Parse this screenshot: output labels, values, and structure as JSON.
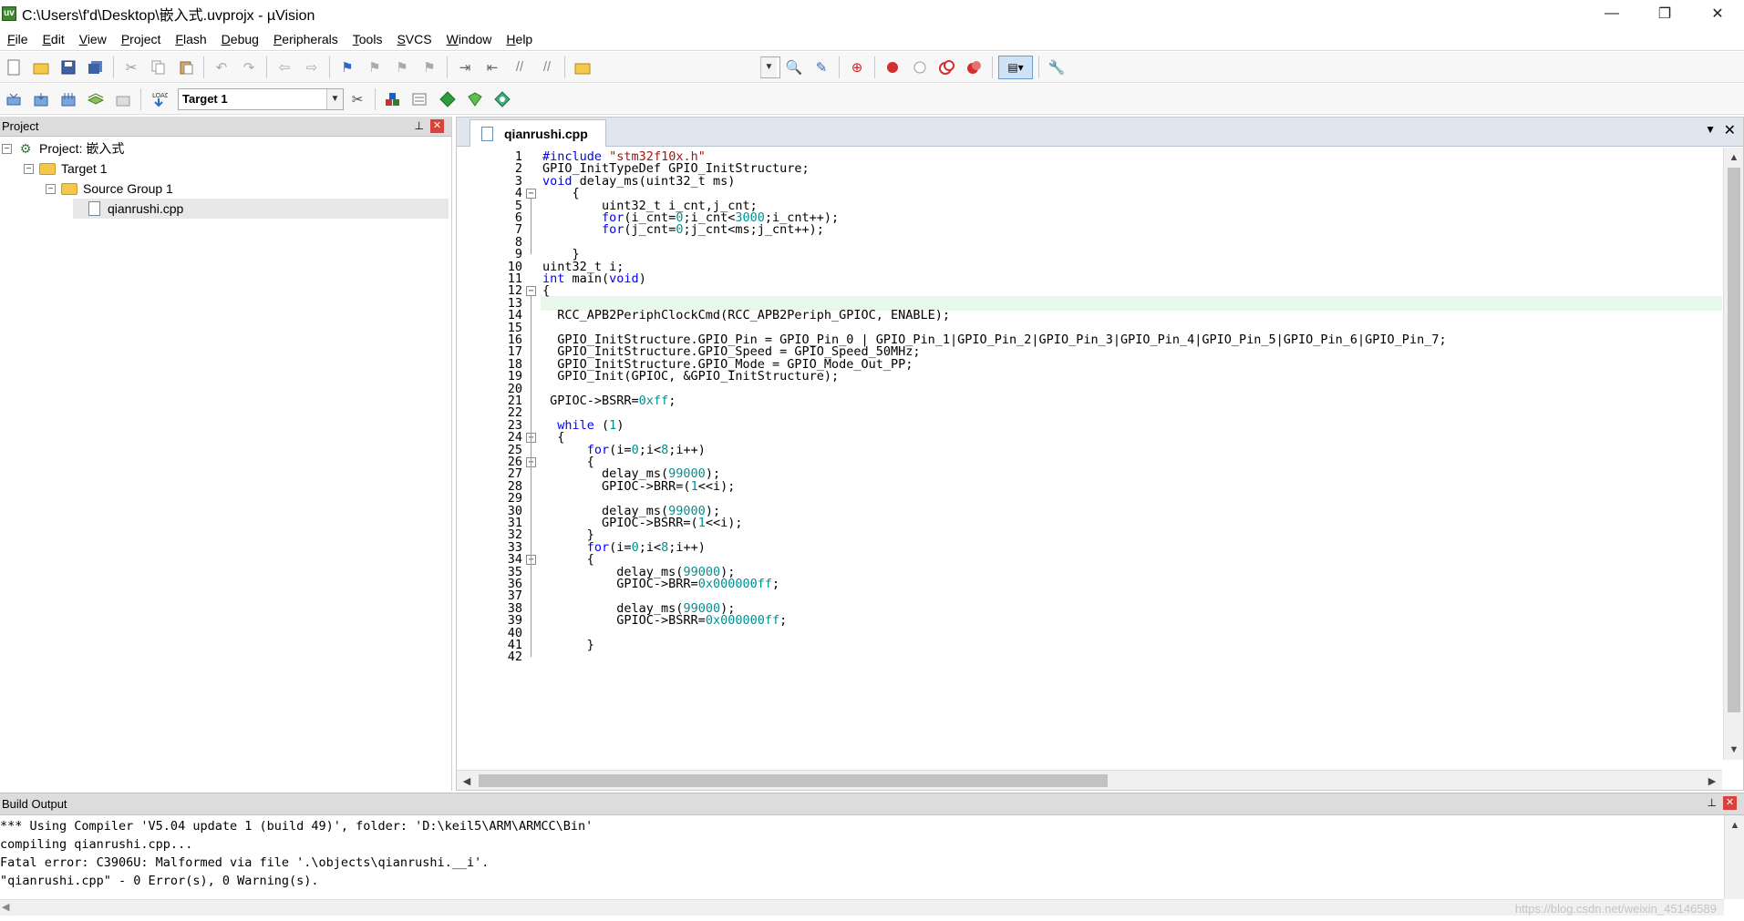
{
  "window": {
    "title": "C:\\Users\\f'd\\Desktop\\嵌入式.uvprojx - µVision",
    "app_icon": "uv",
    "minimize": "—",
    "restore": "❐",
    "close": "✕"
  },
  "menu": [
    "File",
    "Edit",
    "View",
    "Project",
    "Flash",
    "Debug",
    "Peripherals",
    "Tools",
    "SVCS",
    "Window",
    "Help"
  ],
  "toolbar2": {
    "target_value": "Target 1"
  },
  "project_panel": {
    "title": "Project",
    "pin": "⊥",
    "close": "✕",
    "tree": {
      "project": "Project: 嵌入式",
      "target": "Target 1",
      "group": "Source Group 1",
      "file": "qianrushi.cpp"
    }
  },
  "editor": {
    "tab_label": "qianrushi.cpp",
    "tab_menu": "▼",
    "tab_close": "✕",
    "lines": [
      {
        "n": "1",
        "text": "#include \"stm32f10x.h\""
      },
      {
        "n": "2",
        "text": "GPIO_InitTypeDef GPIO_InitStructure;"
      },
      {
        "n": "3",
        "text": "void delay_ms(uint32_t ms)"
      },
      {
        "n": "4",
        "text": "    {"
      },
      {
        "n": "5",
        "text": "        uint32_t i_cnt,j_cnt;"
      },
      {
        "n": "6",
        "text": "        for(i_cnt=0;i_cnt<3000;i_cnt++);"
      },
      {
        "n": "7",
        "text": "        for(j_cnt=0;j_cnt<ms;j_cnt++);"
      },
      {
        "n": "8",
        "text": ""
      },
      {
        "n": "9",
        "text": "    }"
      },
      {
        "n": "10",
        "text": "uint32_t i;"
      },
      {
        "n": "11",
        "text": "int main(void)"
      },
      {
        "n": "12",
        "text": "{"
      },
      {
        "n": "13",
        "text": ""
      },
      {
        "n": "14",
        "text": "  RCC_APB2PeriphClockCmd(RCC_APB2Periph_GPIOC, ENABLE);"
      },
      {
        "n": "15",
        "text": ""
      },
      {
        "n": "16",
        "text": "  GPIO_InitStructure.GPIO_Pin = GPIO_Pin_0 | GPIO_Pin_1|GPIO_Pin_2|GPIO_Pin_3|GPIO_Pin_4|GPIO_Pin_5|GPIO_Pin_6|GPIO_Pin_7;"
      },
      {
        "n": "17",
        "text": "  GPIO_InitStructure.GPIO_Speed = GPIO_Speed_50MHz;"
      },
      {
        "n": "18",
        "text": "  GPIO_InitStructure.GPIO_Mode = GPIO_Mode_Out_PP;"
      },
      {
        "n": "19",
        "text": "  GPIO_Init(GPIOC, &GPIO_InitStructure);"
      },
      {
        "n": "20",
        "text": ""
      },
      {
        "n": "21",
        "text": " GPIOC->BSRR=0xff;"
      },
      {
        "n": "22",
        "text": ""
      },
      {
        "n": "23",
        "text": "  while (1)"
      },
      {
        "n": "24",
        "text": "  {"
      },
      {
        "n": "25",
        "text": "      for(i=0;i<8;i++)"
      },
      {
        "n": "26",
        "text": "      {"
      },
      {
        "n": "27",
        "text": "        delay_ms(99000);"
      },
      {
        "n": "28",
        "text": "        GPIOC->BRR=(1<<i);"
      },
      {
        "n": "29",
        "text": ""
      },
      {
        "n": "30",
        "text": "        delay_ms(99000);"
      },
      {
        "n": "31",
        "text": "        GPIOC->BSRR=(1<<i);"
      },
      {
        "n": "32",
        "text": "      }"
      },
      {
        "n": "33",
        "text": "      for(i=0;i<8;i++)"
      },
      {
        "n": "34",
        "text": "      {"
      },
      {
        "n": "35",
        "text": "          delay_ms(99000);"
      },
      {
        "n": "36",
        "text": "          GPIOC->BRR=0x000000ff;"
      },
      {
        "n": "37",
        "text": ""
      },
      {
        "n": "38",
        "text": "          delay_ms(99000);"
      },
      {
        "n": "39",
        "text": "          GPIOC->BSRR=0x000000ff;"
      },
      {
        "n": "40",
        "text": ""
      },
      {
        "n": "41",
        "text": "      }"
      },
      {
        "n": "42",
        "text": ""
      }
    ]
  },
  "build_output": {
    "title": "Build Output",
    "lines": [
      "*** Using Compiler 'V5.04 update 1 (build 49)', folder: 'D:\\keil5\\ARM\\ARMCC\\Bin'",
      "compiling qianrushi.cpp...",
      "Fatal error: C3906U: Malformed via file '.\\objects\\qianrushi.__i'.",
      "\"qianrushi.cpp\" - 0 Error(s), 0 Warning(s)."
    ],
    "watermark": "https://blog.csdn.net/weixin_45146589"
  },
  "colors": {
    "keyword": "#0000ff",
    "number": "#009090",
    "string": "#a31515",
    "current_line": "#e8f8ea"
  }
}
